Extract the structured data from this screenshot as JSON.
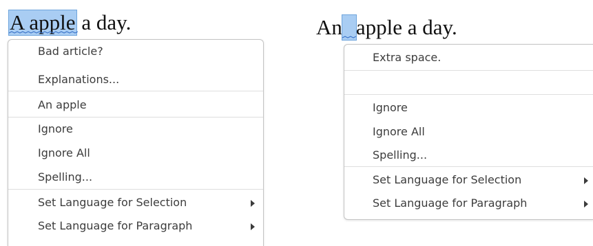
{
  "left_example": {
    "flagged_text": "A apple",
    "rest_text": " a day.",
    "menu": {
      "bad_article": "Bad article?",
      "explanations": "Explanations...",
      "suggestion": "An apple",
      "ignore": "Ignore",
      "ignore_all": "Ignore All",
      "spelling": "Spelling...",
      "set_language_selection": "Set Language for Selection",
      "set_language_paragraph": "Set Language for Paragraph"
    }
  },
  "right_example": {
    "text_before": "An",
    "text_after": "apple a day.",
    "menu": {
      "extra_space": "Extra space.",
      "ignore": "Ignore",
      "ignore_all": "Ignore All",
      "spelling": "Spelling...",
      "set_language_selection": "Set Language for Selection",
      "set_language_paragraph": "Set Language for Paragraph"
    }
  },
  "colors": {
    "selection": "#a9cdf3",
    "squiggle": "#3b73c9",
    "menu_text": "#3c3c3c",
    "separator": "#dedede"
  }
}
